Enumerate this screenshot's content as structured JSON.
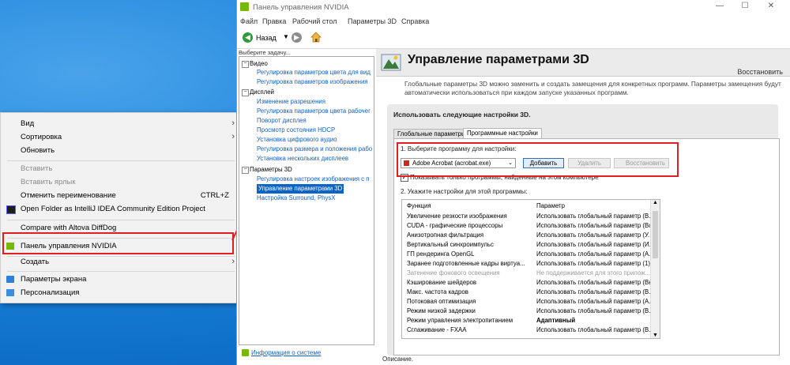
{
  "window": {
    "title": "Панель управления NVIDIA",
    "controls": {
      "minimize": "—",
      "maximize": "☐",
      "close": "✕"
    }
  },
  "menubar": [
    "Файл",
    "Правка",
    "Рабочий стол",
    "Параметры 3D",
    "Справка"
  ],
  "toolbar": {
    "back_label": "Назад"
  },
  "left_pane": {
    "header": "Выберите задачу...",
    "tree": [
      {
        "label": "Видео",
        "type": "category"
      },
      {
        "label": "Регулировка параметров цвета для вид",
        "type": "link"
      },
      {
        "label": "Регулировка параметров изображения",
        "type": "link"
      },
      {
        "label": "Дисплей",
        "type": "category"
      },
      {
        "label": "Изменение разрешения",
        "type": "link"
      },
      {
        "label": "Регулировка параметров цвета рабочег",
        "type": "link"
      },
      {
        "label": "Поворот дисплея",
        "type": "link"
      },
      {
        "label": "Просмотр состояния HDCP",
        "type": "link"
      },
      {
        "label": "Установка цифрового аудио",
        "type": "link"
      },
      {
        "label": "Регулировка размера и положения рабо",
        "type": "link"
      },
      {
        "label": "Установка нескольких дисплеев",
        "type": "link"
      },
      {
        "label": "Параметры 3D",
        "type": "category"
      },
      {
        "label": "Регулировка настроек изображения с п",
        "type": "link"
      },
      {
        "label": "Управление параметрами 3D",
        "type": "selected"
      },
      {
        "label": "Настройка Surround, PhysX",
        "type": "link"
      }
    ],
    "system_info": "Информация о системе"
  },
  "content": {
    "title": "Управление параметрами 3D",
    "restore": "Восстановить",
    "description": "Глобальные параметры 3D можно заменить и создать замещения для конкретных программ. Параметры замещения будут автоматически использоваться при каждом запуске указанных программ.",
    "panel_title": "Использовать следующие настройки 3D.",
    "tabs": [
      "Глобальные параметры",
      "Программные настройки"
    ],
    "step1": "1. Выберите программу для настройки:",
    "selected_program": "Adobe Acrobat (acrobat.exe)",
    "buttons": {
      "add": "Добавить",
      "remove": "Удалить",
      "restore": "Восстановить"
    },
    "show_only_found": "Показывать только программы, найденные на этом компьютере",
    "step2": "2. Укажите настройки для этой программы:",
    "table_headers": {
      "function": "Функция",
      "parameter": "Параметр"
    },
    "settings": [
      {
        "fn": "Увеличение резкости изображения",
        "val": "Использовать глобальный параметр (В..."
      },
      {
        "fn": "CUDA - графические процессоры",
        "val": "Использовать глобальный параметр (Все)"
      },
      {
        "fn": "Анизотропная фильтрация",
        "val": "Использовать глобальный параметр (У..."
      },
      {
        "fn": "Вертикальный синхроимпульс",
        "val": "Использовать глобальный параметр (И..."
      },
      {
        "fn": "ГП рендеринга OpenGL",
        "val": "Использовать глобальный параметр (А..."
      },
      {
        "fn": "Заранее подготовленные кадры виртуа...",
        "val": "Использовать глобальный параметр (1)"
      },
      {
        "fn": "Затенение фонового освещения",
        "val": "Не поддерживается для этого прилож..."
      },
      {
        "fn": "Кэширование шейдеров",
        "val": "Использовать глобальный параметр (Вк..."
      },
      {
        "fn": "Макс. частота кадров",
        "val": "Использовать глобальный параметр (В..."
      },
      {
        "fn": "Потоковая оптимизация",
        "val": "Использовать глобальный параметр (А..."
      },
      {
        "fn": "Режим низкой задержки",
        "val": "Использовать глобальный параметр (В..."
      },
      {
        "fn": "Режим управления электропитанием",
        "val": "Адаптивный"
      },
      {
        "fn": "Сглаживание - FXAA",
        "val": "Использовать глобальный параметр (В..."
      }
    ],
    "footer": "Описание."
  },
  "context_menu": {
    "items": [
      {
        "label": "Вид",
        "arrow": "›"
      },
      {
        "label": "Сортировка",
        "arrow": "›"
      },
      {
        "label": "Обновить"
      },
      {
        "label": "Вставить"
      },
      {
        "label": "Вставить ярлык"
      },
      {
        "label": "Отменить переименование",
        "shortcut": "CTRL+Z"
      },
      {
        "label": "Open Folder as IntelliJ IDEA Community Edition Project"
      },
      {
        "label": "Compare with Altova DiffDog"
      },
      {
        "label": "Панель управления NVIDIA"
      },
      {
        "label": "Создать",
        "arrow": "›"
      },
      {
        "label": "Параметры экрана"
      },
      {
        "label": "Персонализация"
      }
    ]
  },
  "colors": {
    "accent_red": "#e02020",
    "nvidia_green": "#76b900",
    "selection_blue": "#0a64c8"
  }
}
